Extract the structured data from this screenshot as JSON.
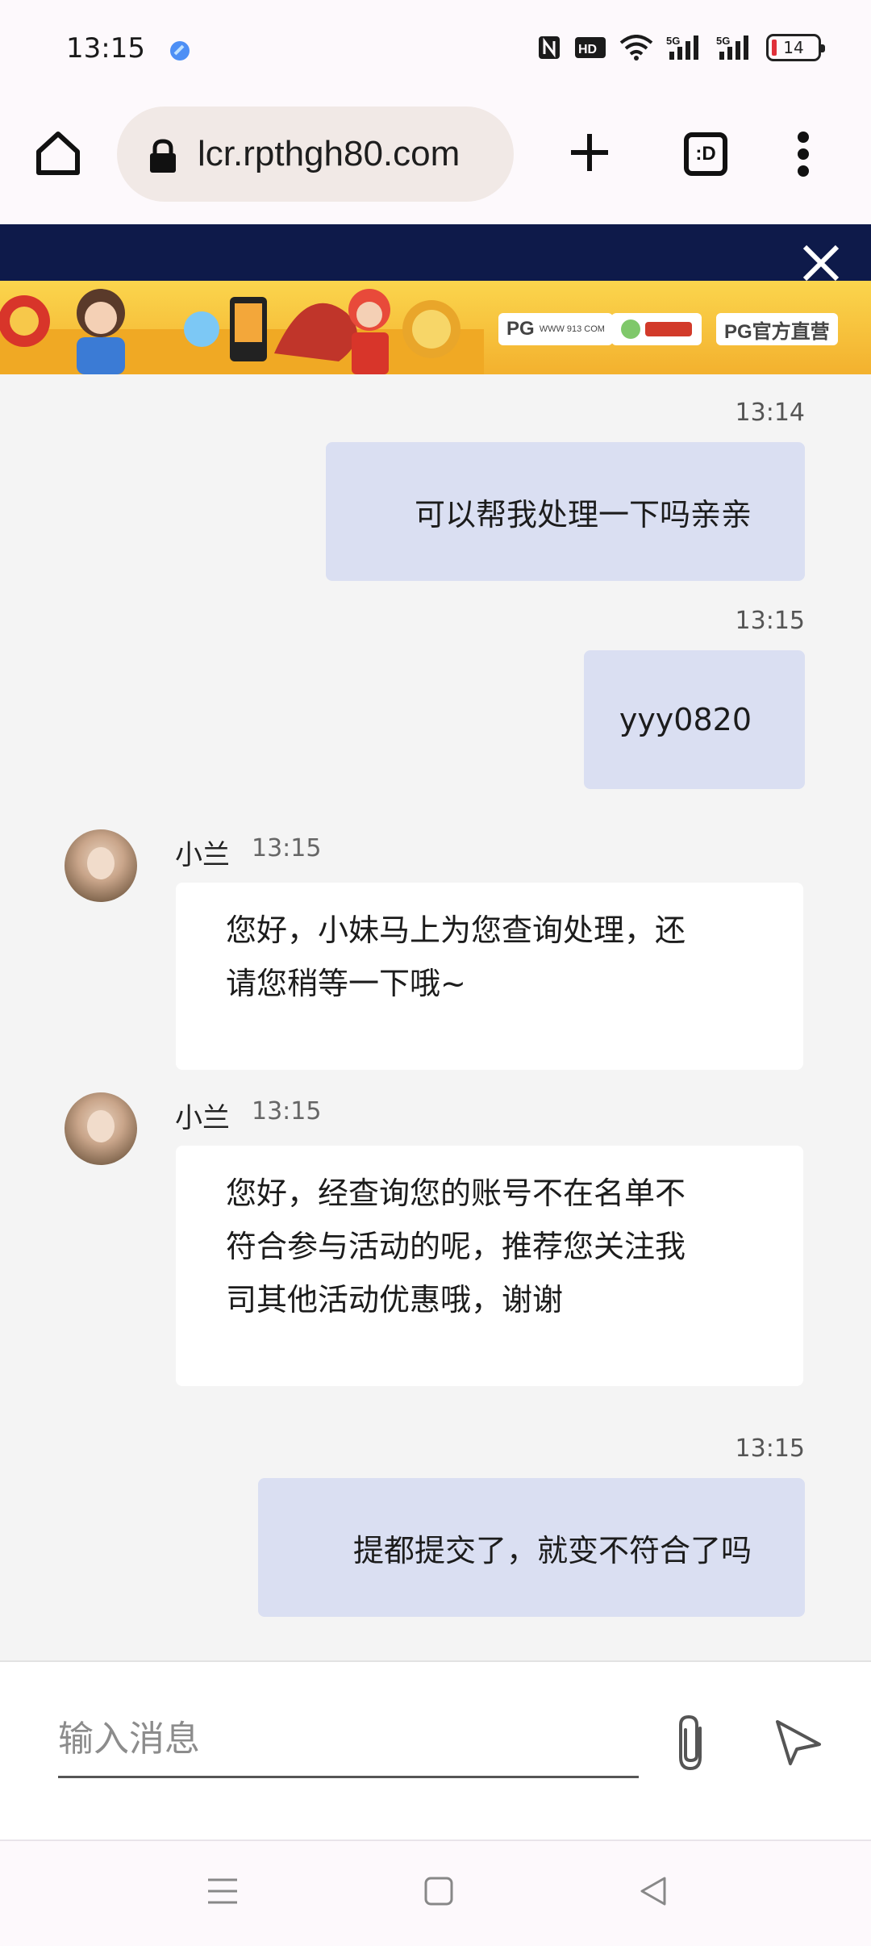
{
  "status_bar": {
    "time": "13:15",
    "icons": [
      "app-dot-icon",
      "nfc-icon",
      "hd-icon",
      "wifi-icon",
      "signal-5g-icon",
      "signal-5g-icon"
    ],
    "battery_level": "14",
    "battery_color": "#e0303a"
  },
  "browser": {
    "url": "lcr.rpthgh80.com",
    "tab_switcher_label": ":D",
    "icons": [
      "home-icon",
      "lock-icon",
      "plus-icon",
      "tab-switcher-icon",
      "more-vert-icon"
    ]
  },
  "banner": {
    "background_color": "#0e1a4a",
    "ad_labels": [
      "PG",
      "PG官方直营"
    ],
    "ad_sublabels": [
      "WWW 913 COM",
      "WWW.913.COM"
    ]
  },
  "chat": {
    "messages": [
      {
        "direction": "out",
        "time": "13:14",
        "text": "可以帮我处理一下吗亲亲"
      },
      {
        "direction": "out",
        "time": "13:15",
        "text": "yyy0820"
      },
      {
        "direction": "in",
        "sender": "小兰",
        "time": "13:15",
        "lines": [
          "您好，小妹马上为您查询处理，还",
          "请您稍等一下哦~"
        ]
      },
      {
        "direction": "in",
        "sender": "小兰",
        "time": "13:15",
        "lines": [
          "您好，经查询您的账号不在名单不",
          "符合参与活动的呢，推荐您关注我",
          "司其他活动优惠哦，谢谢"
        ]
      },
      {
        "direction": "out",
        "time": "13:15",
        "text": "提都提交了，就变不符合了吗"
      }
    ]
  },
  "composer": {
    "placeholder": "输入消息",
    "value": ""
  },
  "nav": {
    "icons": [
      "menu-icon",
      "home-square-icon",
      "back-icon"
    ]
  }
}
